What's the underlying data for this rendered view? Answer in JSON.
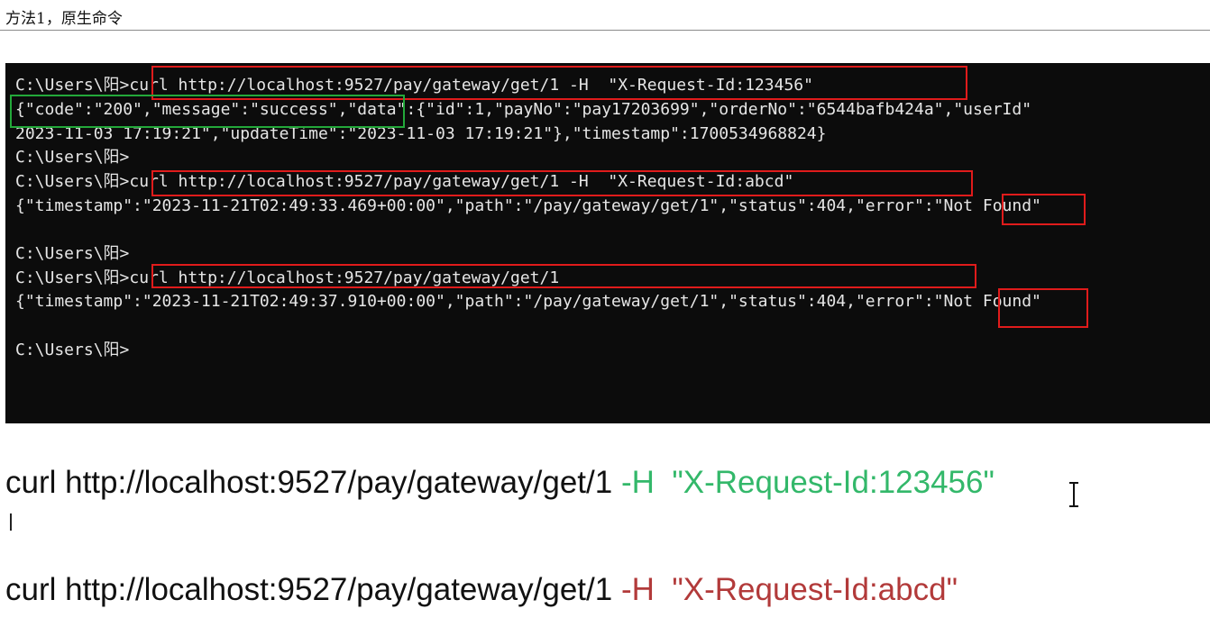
{
  "doc": {
    "heading": "方法1，原生命令"
  },
  "terminal": {
    "lines": [
      "C:\\Users\\阳>curl http://localhost:9527/pay/gateway/get/1 -H  \"X-Request-Id:123456\"",
      "{\"code\":\"200\",\"message\":\"success\",\"data\":{\"id\":1,\"payNo\":\"pay17203699\",\"orderNo\":\"6544bafb424a\",\"userId\"",
      "2023-11-03 17:19:21\",\"updateTime\":\"2023-11-03 17:19:21\"},\"timestamp\":1700534968824}",
      "C:\\Users\\阳>",
      "C:\\Users\\阳>curl http://localhost:9527/pay/gateway/get/1 -H  \"X-Request-Id:abcd\"",
      "{\"timestamp\":\"2023-11-21T02:49:33.469+00:00\",\"path\":\"/pay/gateway/get/1\",\"status\":404,\"error\":\"Not Found\"",
      "",
      "C:\\Users\\阳>",
      "C:\\Users\\阳>curl http://localhost:9527/pay/gateway/get/1",
      "{\"timestamp\":\"2023-11-21T02:49:37.910+00:00\",\"path\":\"/pay/gateway/get/1\",\"status\":404,\"error\":\"Not Found\"",
      "",
      "C:\\Users\\阳>"
    ]
  },
  "commands": {
    "cmd1": {
      "base": "curl http://localhost:9527/pay/gateway/get/1 ",
      "flag": "-H",
      "header": "\"X-Request-Id:123456\""
    },
    "cmd2": {
      "base": "curl http://localhost:9527/pay/gateway/get/1 ",
      "flag": "-H",
      "header": "\"X-Request-Id:abcd\""
    }
  },
  "colors": {
    "highlight_red": "#e01b1b",
    "highlight_green": "#23a83a",
    "header_green": "#33b86a",
    "header_red": "#b23a3a"
  },
  "icons": {
    "mouse": "text-ibeam-cursor-icon"
  }
}
